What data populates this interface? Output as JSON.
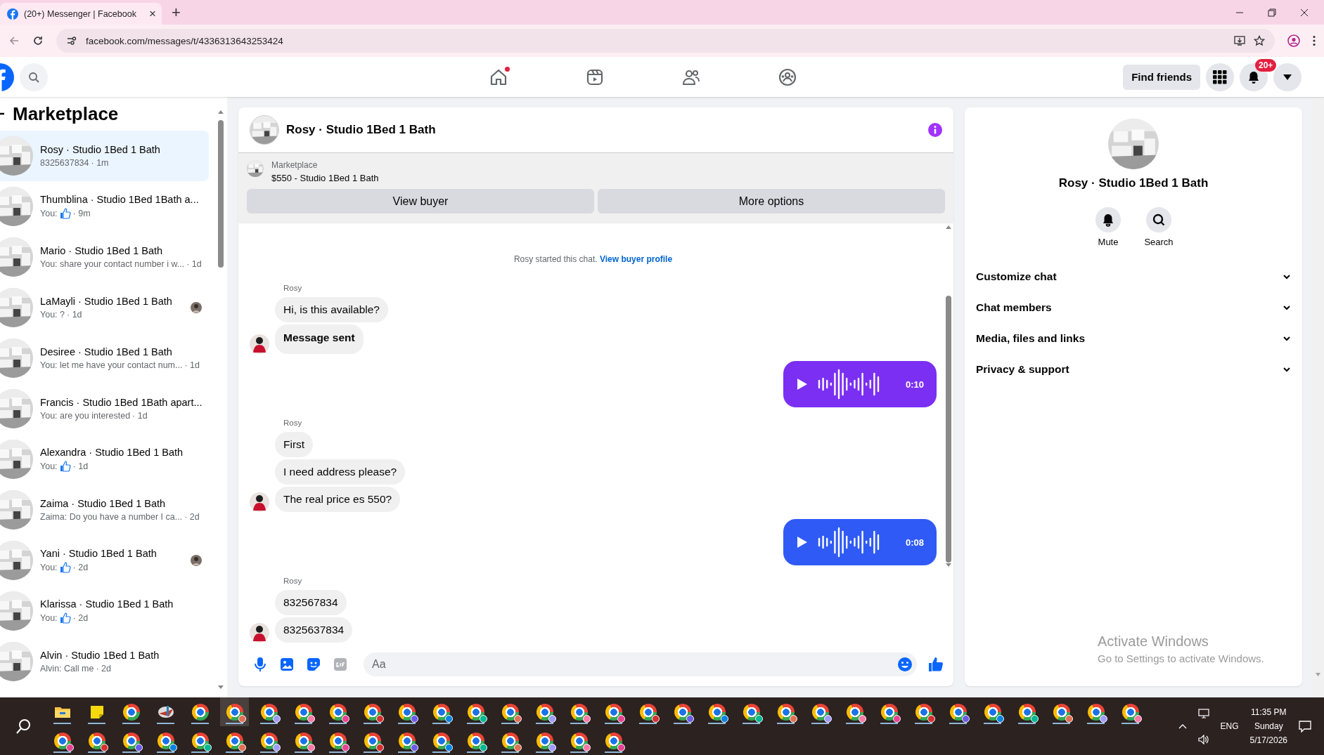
{
  "browser": {
    "tab_title": "(20+) Messenger | Facebook",
    "tab_close": "×",
    "new_tab": "+",
    "url": "facebook.com/messages/t/4336313643253424"
  },
  "top_nav": {
    "nav_items": [
      {
        "kind": "home",
        "notification": true
      },
      {
        "kind": "video",
        "notification": false
      },
      {
        "kind": "friends",
        "notification": false
      },
      {
        "kind": "groups",
        "notification": false
      }
    ],
    "find_friends": "Find friends",
    "notifications_badge": "20+"
  },
  "sidebar": {
    "title": "Marketplace",
    "conversations": [
      {
        "name": "Rosy · Studio 1Bed 1 Bath",
        "preview": "8325637834",
        "like": false,
        "time": "· 1m",
        "seen": false,
        "selected": true
      },
      {
        "name": "Thumblina · Studio 1Bed 1Bath a...",
        "preview": "You:",
        "like": true,
        "time": "· 9m",
        "seen": false,
        "selected": false
      },
      {
        "name": "Mario · Studio 1Bed 1 Bath",
        "preview": "You: share your contact number i w...",
        "like": false,
        "time": "· 1d",
        "seen": false,
        "selected": false
      },
      {
        "name": "LaMayli · Studio 1Bed 1 Bath",
        "preview": "You: ?",
        "like": false,
        "time": "· 1d",
        "seen": true,
        "selected": false
      },
      {
        "name": "Desiree · Studio 1Bed 1 Bath",
        "preview": "You: let me have your contact num...",
        "like": false,
        "time": "· 1d",
        "seen": false,
        "selected": false
      },
      {
        "name": "Francis · Studio 1Bed 1Bath apart...",
        "preview": "You: are you interested",
        "like": false,
        "time": "· 1d",
        "seen": false,
        "selected": false
      },
      {
        "name": "Alexandra · Studio 1Bed 1 Bath",
        "preview": "You:",
        "like": true,
        "time": "· 1d",
        "seen": false,
        "selected": false
      },
      {
        "name": "Zaima · Studio 1Bed 1 Bath",
        "preview": "Zaima: Do you have a number I ca...",
        "like": false,
        "time": "· 2d",
        "seen": false,
        "selected": false
      },
      {
        "name": "Yani · Studio 1Bed 1 Bath",
        "preview": "You:",
        "like": true,
        "time": "· 2d",
        "seen": true,
        "selected": false
      },
      {
        "name": "Klarissa · Studio 1Bed 1 Bath",
        "preview": "You:",
        "like": true,
        "time": "· 2d",
        "seen": false,
        "selected": false
      },
      {
        "name": "Alvin · Studio 1Bed 1 Bath",
        "preview": "Alvin: Call me",
        "like": false,
        "time": "· 2d",
        "seen": false,
        "selected": false
      }
    ]
  },
  "chat": {
    "title": "Rosy · Studio 1Bed 1 Bath",
    "listing": {
      "label": "Marketplace",
      "title": "$550 - Studio 1Bed 1 Bath"
    },
    "buttons": [
      "View buyer",
      "More options"
    ],
    "system_note": {
      "text": "Rosy started this chat.",
      "link": "View buyer profile"
    },
    "messages": [
      {
        "kind": "incoming",
        "sender": "Rosy",
        "bubbles": [
          {
            "text": "Hi, is this available?",
            "bold": false
          },
          {
            "text": "Message sent",
            "bold": true
          }
        ]
      },
      {
        "kind": "audio",
        "duration": "0:10",
        "color": "#7b2ff2"
      },
      {
        "kind": "incoming",
        "sender": "Rosy",
        "bubbles": [
          {
            "text": "First",
            "bold": false
          },
          {
            "text": "I need address please?",
            "bold": false
          },
          {
            "text": "The real price es 550?",
            "bold": false
          }
        ]
      },
      {
        "kind": "audio",
        "duration": "0:08",
        "color": "#2f5af5"
      },
      {
        "kind": "incoming",
        "sender": "Rosy",
        "bubbles": [
          {
            "text": "832567834",
            "bold": false
          },
          {
            "text": "8325637834",
            "bold": false
          }
        ]
      }
    ],
    "composer": {
      "placeholder": "Aa"
    }
  },
  "info_panel": {
    "name": "Rosy · Studio 1Bed 1 Bath",
    "actions": [
      {
        "kind": "mute",
        "label": "Mute"
      },
      {
        "kind": "search",
        "label": "Search"
      }
    ],
    "sections": [
      {
        "label": "Customize chat",
        "expanded": false
      },
      {
        "label": "Chat members",
        "expanded": false
      },
      {
        "label": "Media, files and links",
        "expanded": false
      },
      {
        "label": "Privacy & support",
        "expanded": false
      }
    ]
  },
  "windows_notice": {
    "title": "Activate Windows",
    "text": "Go to Settings to activate Windows."
  },
  "taskbar": {
    "language": "ENG",
    "time": "11:35 PM",
    "day": "Sunday",
    "date": "5/17/2026"
  }
}
